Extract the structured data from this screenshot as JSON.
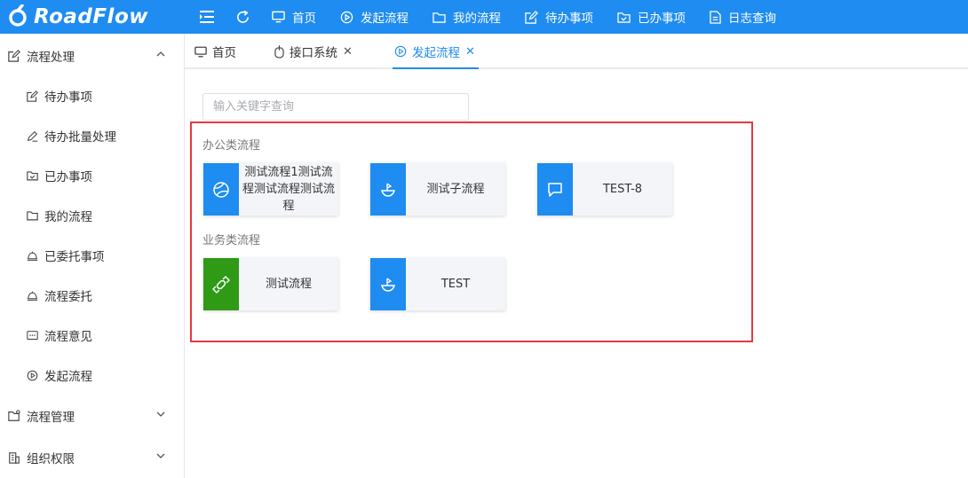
{
  "app": {
    "logo_text": "RoadFlow"
  },
  "top_nav": [
    {
      "label": "首页",
      "icon": "monitor-icon"
    },
    {
      "label": "发起流程",
      "icon": "play-circle-icon"
    },
    {
      "label": "我的流程",
      "icon": "folder-icon"
    },
    {
      "label": "待办事项",
      "icon": "edit-icon"
    },
    {
      "label": "已办事项",
      "icon": "folder-check-icon"
    },
    {
      "label": "日志查询",
      "icon": "document-icon"
    }
  ],
  "sidebar": {
    "group_process": "流程处理",
    "items": [
      {
        "label": "待办事项",
        "icon": "edit-icon"
      },
      {
        "label": "待办批量处理",
        "icon": "pen-icon"
      },
      {
        "label": "已办事项",
        "icon": "folder-check-icon"
      },
      {
        "label": "我的流程",
        "icon": "folder-icon"
      },
      {
        "label": "已委托事项",
        "icon": "bell-icon"
      },
      {
        "label": "流程委托",
        "icon": "bell-icon"
      },
      {
        "label": "流程意见",
        "icon": "message-dots-icon"
      },
      {
        "label": "发起流程",
        "icon": "play-circle-icon"
      }
    ],
    "group_manage": "流程管理",
    "group_org": "组织权限"
  },
  "tabs": [
    {
      "label": "首页",
      "icon": "monitor-icon"
    },
    {
      "label": "接口系统",
      "icon": "mouse-icon",
      "close": "✕"
    },
    {
      "label": "发起流程",
      "icon": "play-circle-icon",
      "close": "✕",
      "active": true
    }
  ],
  "search": {
    "placeholder": "输入关键字查询",
    "value": ""
  },
  "categories": [
    {
      "title": "办公类流程",
      "flows": [
        {
          "label": "测试流程1测试流程测试流程测试流程",
          "icon": "basketball-icon",
          "color": "#1e8cf0"
        },
        {
          "label": "测试子流程",
          "icon": "ship-icon",
          "color": "#1e8cf0"
        },
        {
          "label": "TEST-8",
          "icon": "chat-bubble-icon",
          "color": "#1e8cf0"
        }
      ]
    },
    {
      "title": "业务类流程",
      "flows": [
        {
          "label": "测试流程",
          "icon": "candy-icon",
          "color": "#2e9a16"
        },
        {
          "label": "TEST",
          "icon": "ship-icon",
          "color": "#1e8cf0"
        }
      ]
    }
  ],
  "colors": {
    "brand": "#1e8cf0",
    "highlight_border": "#e5393f",
    "green": "#2e9a16"
  }
}
